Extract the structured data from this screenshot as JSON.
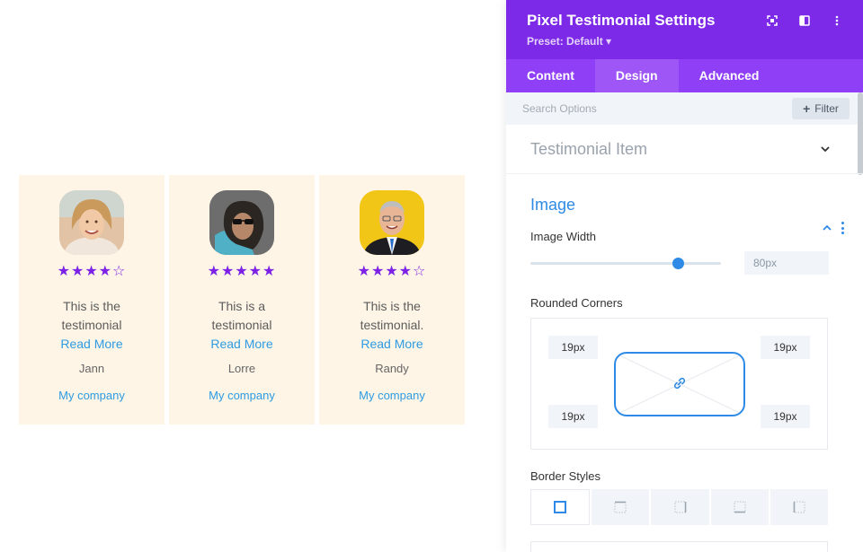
{
  "testimonials": [
    {
      "stars": "★★★★☆",
      "quote": "This is the testimonial",
      "read_more": "Read More",
      "author": "Jann",
      "company": "My company",
      "avatar_bg": "#d9b79b"
    },
    {
      "stars": "★★★★★",
      "quote": "This is a testimonial",
      "read_more": "Read More",
      "author": "Lorre",
      "company": "My company",
      "avatar_bg": "#6f6f6f"
    },
    {
      "stars": "★★★★☆",
      "quote": "This is the testimonial.",
      "read_more": "Read More",
      "author": "Randy",
      "company": "My company",
      "avatar_bg": "#f2c617"
    }
  ],
  "panel": {
    "title": "Pixel Testimonial Settings",
    "preset": "Preset: Default ▾",
    "header_icons": [
      "fullscreen-icon",
      "split-view-icon",
      "more-options-icon"
    ],
    "tabs": [
      {
        "label": "Content",
        "active": false
      },
      {
        "label": "Design",
        "active": true
      },
      {
        "label": "Advanced",
        "active": false
      }
    ],
    "search_placeholder": "Search Options",
    "filter_label": "Filter",
    "sections": {
      "testimonial_item": {
        "title": "Testimonial Item",
        "expanded": false
      },
      "image": {
        "title": "Image",
        "expanded": true,
        "image_width_label": "Image Width",
        "image_width_value": "80px",
        "image_width_slider_fraction": 0.77,
        "rounded_corners_label": "Rounded Corners",
        "corners": {
          "top_left": "19px",
          "top_right": "19px",
          "bottom_left": "19px",
          "bottom_right": "19px"
        },
        "corners_linked": true,
        "border_styles_label": "Border Styles",
        "border_style_options": [
          "all-sides",
          "top",
          "right",
          "bottom",
          "left"
        ],
        "border_style_selected": "all-sides"
      }
    }
  },
  "colors": {
    "accent_purple": "#7d2ae8",
    "tab_bar": "#8f3ff5",
    "star": "#7b22e6",
    "link_blue": "#2e9be2",
    "section_blue": "#2e8ae6",
    "card_bg": "#fef5e6"
  }
}
